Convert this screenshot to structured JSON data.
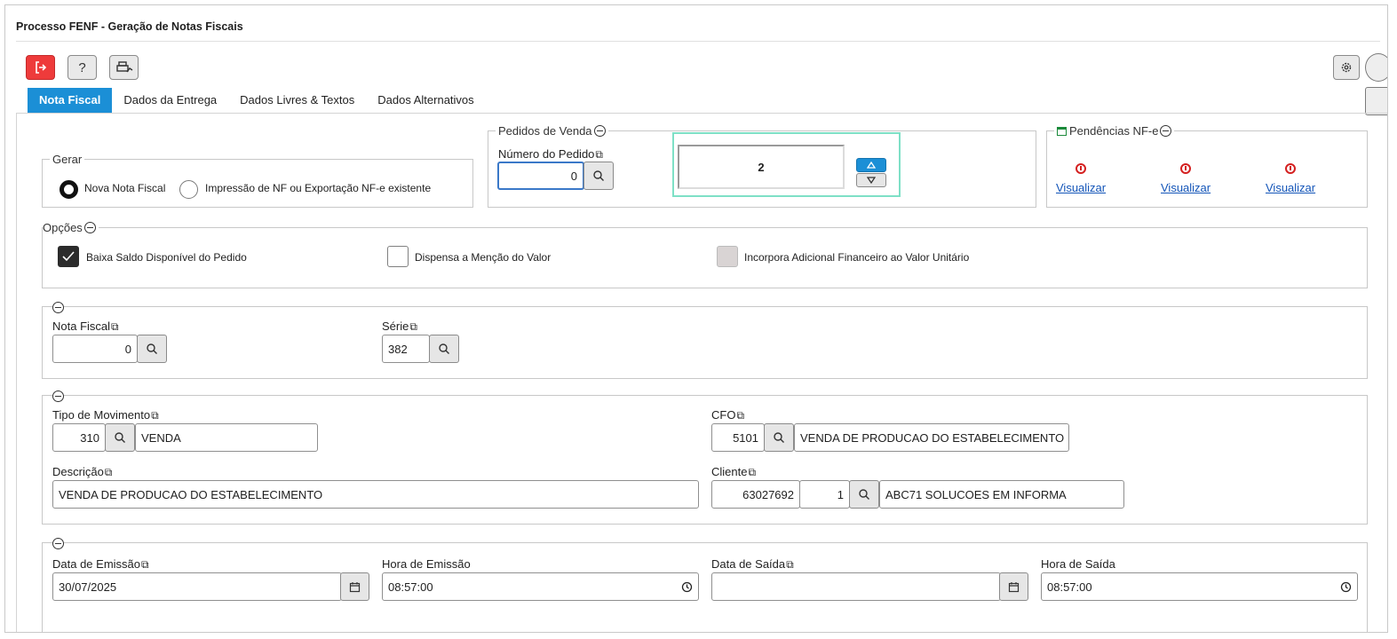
{
  "window": {
    "title": "Processo FENF - Geração de Notas Fiscais"
  },
  "toolbar": {
    "exit_icon": "exit-icon",
    "help_label": "?",
    "print_icon": "printer-icon",
    "settings_icon": "gear-icon"
  },
  "tabs": [
    {
      "label": "Nota Fiscal",
      "active": true
    },
    {
      "label": "Dados da Entrega"
    },
    {
      "label": "Dados Livres & Textos"
    },
    {
      "label": "Dados Alternativos"
    }
  ],
  "gerar": {
    "legend": "Gerar",
    "options": [
      {
        "label": "Nova Nota Fiscal",
        "selected": true
      },
      {
        "label": "Impressão de NF ou Exportação NF-e existente",
        "selected": false
      }
    ]
  },
  "pedidos": {
    "legend": "Pedidos de Venda",
    "numero_label": "Número do Pedido",
    "numero_value": "0",
    "quantity_value": "2"
  },
  "pendencias": {
    "legend": "Pendências NF-e",
    "links": [
      "Visualizar",
      "Visualizar",
      "Visualizar"
    ]
  },
  "opcoes": {
    "legend": "Opções",
    "items": [
      {
        "label": "Baixa Saldo Disponível do Pedido",
        "state": "checked"
      },
      {
        "label": "Dispensa a Menção do Valor",
        "state": "unchecked"
      },
      {
        "label": "Incorpora Adicional Financeiro ao Valor Unitário",
        "state": "disabled"
      }
    ]
  },
  "nota": {
    "nf_label": "Nota Fiscal",
    "nf_value": "0",
    "serie_label": "Série",
    "serie_value": "382"
  },
  "movimento": {
    "tipo_label": "Tipo de Movimento",
    "tipo_code": "310",
    "tipo_desc": "VENDA",
    "cfo_label": "CFO",
    "cfo_code": "5101",
    "cfo_desc": "VENDA DE PRODUCAO DO ESTABELECIMENTO",
    "descricao_label": "Descrição",
    "descricao_value": "VENDA DE PRODUCAO DO ESTABELECIMENTO",
    "cliente_label": "Cliente",
    "cliente_code": "63027692",
    "cliente_seq": "1",
    "cliente_name": "ABC71 SOLUCOES EM INFORMA"
  },
  "datas": {
    "emissao_label": "Data de Emissão",
    "emissao_value": "30/07/2025",
    "hora_emissao_label": "Hora de Emissão",
    "hora_emissao_value": "08:57:00",
    "saida_label": "Data de Saída",
    "saida_value": "",
    "hora_saida_label": "Hora de Saída",
    "hora_saida_value": "08:57:00"
  }
}
